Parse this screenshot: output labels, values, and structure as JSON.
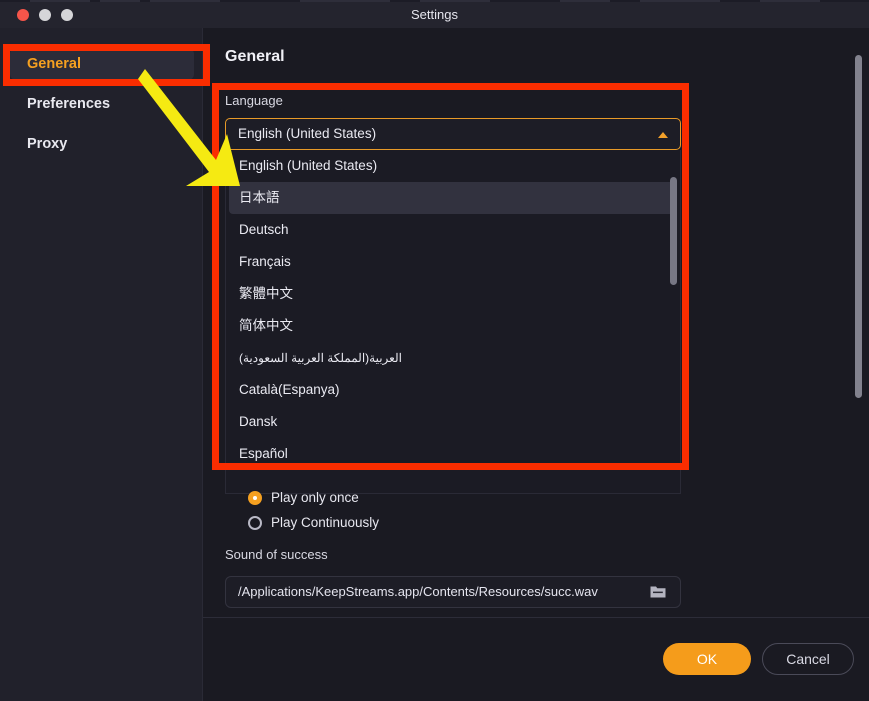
{
  "window": {
    "title": "Settings",
    "traffic_lights": [
      "close",
      "minimize",
      "maximize"
    ]
  },
  "sidebar": {
    "items": [
      {
        "label": "General",
        "active": true
      },
      {
        "label": "Preferences",
        "active": false
      },
      {
        "label": "Proxy",
        "active": false
      }
    ]
  },
  "main": {
    "section_title": "General",
    "language": {
      "label": "Language",
      "selected": "English (United States)",
      "expanded": true,
      "options": [
        {
          "label": "English (United States)",
          "highlighted": false,
          "rtl": false
        },
        {
          "label": "日本語",
          "highlighted": true,
          "rtl": false
        },
        {
          "label": "Deutsch",
          "highlighted": false,
          "rtl": false
        },
        {
          "label": "Français",
          "highlighted": false,
          "rtl": false
        },
        {
          "label": "繁體中文",
          "highlighted": false,
          "rtl": false
        },
        {
          "label": "简体中文",
          "highlighted": false,
          "rtl": false
        },
        {
          "label": "العربية(المملكة العربية السعودية)",
          "highlighted": false,
          "rtl": true
        },
        {
          "label": "Català(Espanya)",
          "highlighted": false,
          "rtl": false
        },
        {
          "label": "Dansk",
          "highlighted": false,
          "rtl": false
        },
        {
          "label": "Español",
          "highlighted": false,
          "rtl": false
        }
      ]
    },
    "play_mode": {
      "options": [
        {
          "label": "Play only once",
          "selected": true
        },
        {
          "label": "Play Continuously",
          "selected": false
        }
      ]
    },
    "sound_of_success": {
      "label": "Sound of success",
      "value": "/Applications/KeepStreams.app/Contents/Resources/succ.wav",
      "browse_icon": "folder-icon"
    }
  },
  "footer": {
    "ok_label": "OK",
    "cancel_label": "Cancel"
  },
  "annotations": {
    "highlight_color": "#fa2d00",
    "arrow_color": "#f5ea12",
    "boxes": [
      "sidebar-general-item",
      "language-section"
    ],
    "arrow": "points-from-general-item-to-language-dropdown"
  },
  "colors": {
    "accent": "#f5a020",
    "window_bg": "#1a1a22",
    "sidebar_bg": "#21212b",
    "titlebar_bg": "#24242e",
    "highlight_row": "#32323f"
  }
}
